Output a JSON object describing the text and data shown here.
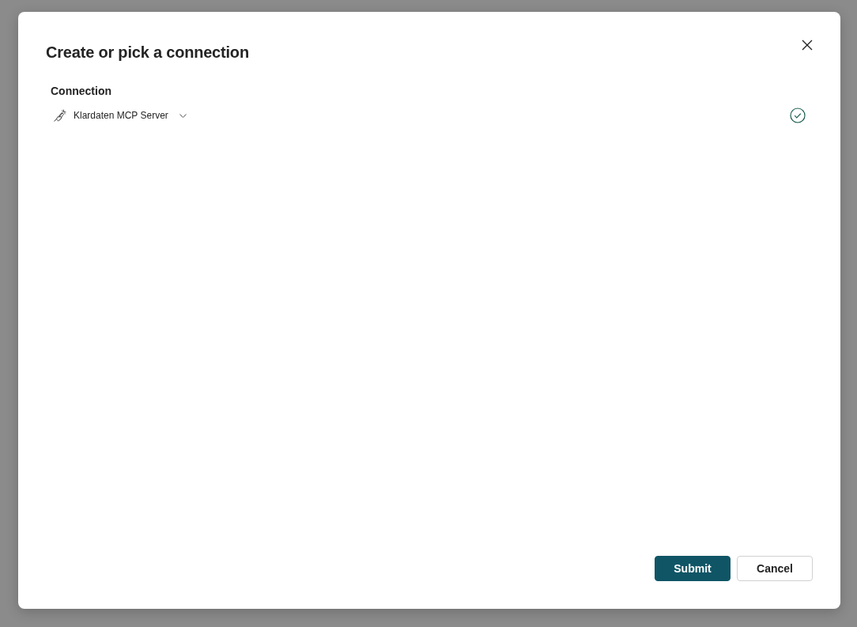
{
  "dialog": {
    "title": "Create or pick a connection"
  },
  "connection": {
    "label": "Connection",
    "value": "Klardaten MCP Server",
    "verified": true
  },
  "buttons": [
    {
      "label": "Submit",
      "kind": "primary"
    },
    {
      "label": "Cancel",
      "kind": "secondary"
    }
  ]
}
